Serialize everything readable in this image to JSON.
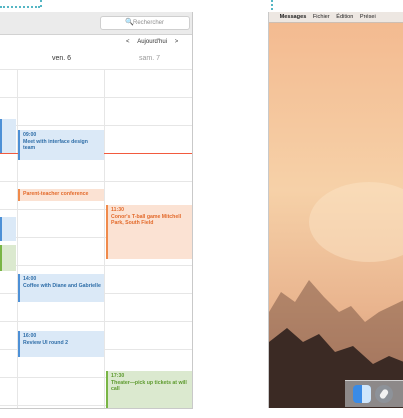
{
  "calendar": {
    "search_placeholder": "Rechercher",
    "search_glyph": "🔍",
    "nav": {
      "prev": "<",
      "today": "Aujourd'hui",
      "next": ">"
    },
    "days": [
      "ven. 6",
      "sam. 7"
    ],
    "events": [
      {
        "id": "meet",
        "time": "09:00",
        "title": "Meet with interface design team",
        "color": "blue"
      },
      {
        "id": "parent",
        "time": "",
        "title": "Parent-teacher conference",
        "color": "orange"
      },
      {
        "id": "tball",
        "time": "11:30",
        "title": "Conor's T-ball game Mitchell Park, South Field",
        "color": "orange"
      },
      {
        "id": "coffee",
        "time": "14:00",
        "title": "Coffee with Diane and Gabrielle",
        "color": "blue"
      },
      {
        "id": "review",
        "time": "16:00",
        "title": "Review UI round 2",
        "color": "blue"
      },
      {
        "id": "theater",
        "time": "17:30",
        "title": "Theater—pick up tickets at will call",
        "color": "green"
      }
    ]
  },
  "desktop": {
    "apple_glyph": "",
    "menu": [
      "Messages",
      "Fichier",
      "Édition",
      "Prései"
    ],
    "dock_icons": [
      "finder-icon",
      "launchpad-icon"
    ]
  },
  "colors": {
    "accent": "#55b6c4",
    "now_line": "#f25a3e"
  }
}
